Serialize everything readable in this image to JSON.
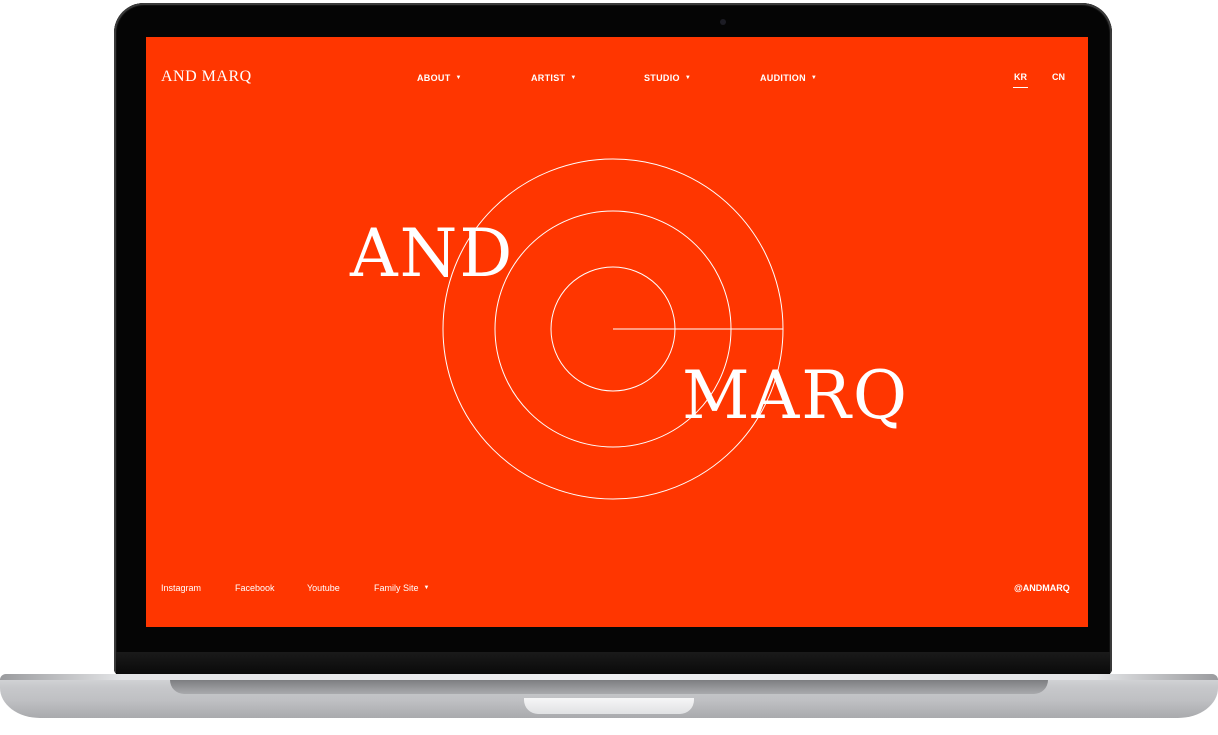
{
  "header": {
    "logo": "AND MARQ",
    "nav": [
      {
        "label": "ABOUT"
      },
      {
        "label": "ARTIST"
      },
      {
        "label": "STUDIO"
      },
      {
        "label": "AUDITION"
      }
    ],
    "languages": [
      "KR",
      "CN"
    ],
    "active_language": "KR"
  },
  "hero": {
    "line1": "AND",
    "line2": "MARQ"
  },
  "footer": {
    "links": [
      "Instagram",
      "Facebook",
      "Youtube"
    ],
    "family_site": "Family Site",
    "handle": "@ANDMARQ"
  },
  "colors": {
    "brand_background": "#ff3600",
    "foreground": "#ffffff"
  },
  "icons": {
    "dropdown": "caret-down-icon"
  }
}
